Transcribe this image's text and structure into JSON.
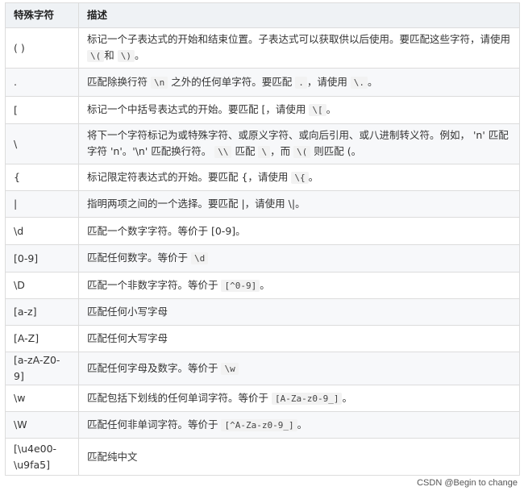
{
  "table": {
    "headers": [
      "特殊字符",
      "描述"
    ],
    "rows": [
      {
        "char": "( )",
        "desc_html": "标记一个子表达式的开始和结束位置。子表达式可以获取供以后使用。要匹配这些字符，请使用 <code>\\(</code>和 <code>\\)</code>。"
      },
      {
        "char": ".",
        "desc_html": "匹配除换行符 <code>\\n</code> 之外的任何单字符。要匹配 <code>.</code>，请使用 <code>\\.</code>。"
      },
      {
        "char": "[",
        "desc_html": "标记一个中括号表达式的开始。要匹配 [，请使用 <code>\\[</code>。"
      },
      {
        "char": "\\",
        "desc_html": "将下一个字符标记为或特殊字符、或原义字符、或向后引用、或八进制转义符。例如， 'n' 匹配字符 'n'。'\\n' 匹配换行符。 <code>\\\\</code> 匹配 <code>\\</code>，而 <code>\\(</code> 则匹配 (。"
      },
      {
        "char": "{",
        "desc_html": "标记限定符表达式的开始。要匹配 {，请使用 <code>\\{</code>。"
      },
      {
        "char": "|",
        "desc_html": "指明两项之间的一个选择。要匹配 |，请使用 \\|。"
      },
      {
        "char": "\\d",
        "desc_html": "匹配一个数字字符。等价于 [0-9]。"
      },
      {
        "char": "[0-9]",
        "desc_html": "匹配任何数字。等价于 <code>\\d</code>"
      },
      {
        "char": "\\D",
        "desc_html": "匹配一个非数字字符。等价于 <code>[^0-9]</code>。"
      },
      {
        "char": "[a-z]",
        "desc_html": "匹配任何小写字母"
      },
      {
        "char": "[A-Z]",
        "desc_html": "匹配任何大写字母"
      },
      {
        "char": "[a-zA-Z0-9]",
        "desc_html": "匹配任何字母及数字。等价于 <code>\\w</code>"
      },
      {
        "char": "\\w",
        "desc_html": "匹配包括下划线的任何单词字符。等价于 <code>[A-Za-z0-9_]</code>。"
      },
      {
        "char": "\\W",
        "desc_html": "匹配任何非单词字符。等价于 <code>[^A-Za-z0-9_]</code>。"
      },
      {
        "char": "[\\u4e00-\\u9fa5]",
        "desc_html": "匹配纯中文"
      }
    ]
  },
  "watermark": "CSDN @Begin to change"
}
